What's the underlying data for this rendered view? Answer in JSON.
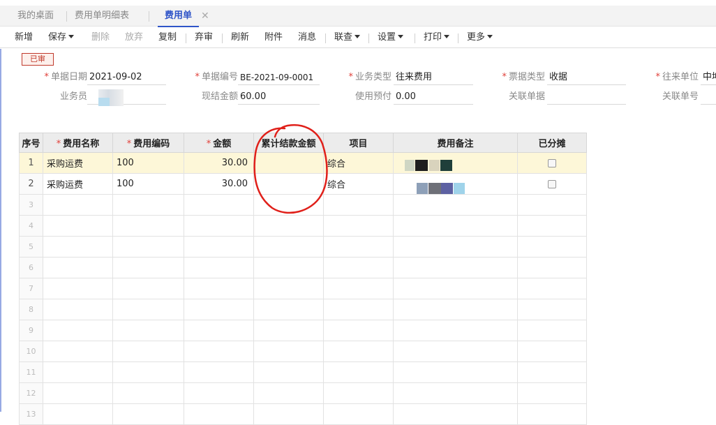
{
  "tabs": [
    {
      "label": "我的桌面",
      "active": false
    },
    {
      "label": "费用单明细表",
      "active": false
    },
    {
      "label": "费用单",
      "active": true
    }
  ],
  "toolbar": {
    "new": "新增",
    "save": "保存",
    "delete": "删除",
    "discard": "放弃",
    "copy": "复制",
    "unaudit": "弃审",
    "refresh": "刷新",
    "attachment": "附件",
    "message": "消息",
    "link": "联查",
    "settings": "设置",
    "print": "打印",
    "more": "更多"
  },
  "status_badge": "已审",
  "form": {
    "doc_date": {
      "label": "单据日期",
      "value": "2021-09-02",
      "required": true
    },
    "doc_no": {
      "label": "单据编号",
      "value": "BE-2021-09-0001",
      "required": true
    },
    "biz_type": {
      "label": "业务类型",
      "value": "往来费用",
      "required": true
    },
    "invoice_type": {
      "label": "票据类型",
      "value": "收据",
      "required": true
    },
    "partner": {
      "label": "往来单位",
      "value": "中坤",
      "required": true
    },
    "salesman": {
      "label": "业务员",
      "value": ""
    },
    "cash_amount": {
      "label": "现结金额",
      "value": "60.00"
    },
    "use_prepay": {
      "label": "使用预付",
      "value": "0.00"
    },
    "related_doc": {
      "label": "关联单据",
      "value": ""
    },
    "related_no": {
      "label": "关联单号",
      "value": ""
    }
  },
  "grid": {
    "columns": [
      {
        "label": "序号",
        "required": false
      },
      {
        "label": "费用名称",
        "required": true
      },
      {
        "label": "费用编码",
        "required": true
      },
      {
        "label": "金额",
        "required": true
      },
      {
        "label": "累计结款金额",
        "required": false
      },
      {
        "label": "项目",
        "required": false
      },
      {
        "label": "费用备注",
        "required": false
      },
      {
        "label": "已分摊",
        "required": false
      }
    ],
    "rows": [
      {
        "seq": "1",
        "name": "采购运费",
        "code": "100",
        "amount": "30.00",
        "settled": "",
        "project": "综合",
        "remark": "",
        "allocated": false
      },
      {
        "seq": "2",
        "name": "采购运费",
        "code": "100",
        "amount": "30.00",
        "settled": "",
        "project": "综合",
        "remark": "",
        "allocated": false
      }
    ],
    "empty_rows": [
      "3",
      "4",
      "5",
      "6",
      "7",
      "8",
      "9",
      "10",
      "11",
      "12",
      "13"
    ]
  },
  "colors": {
    "accent": "#2f54c8",
    "badge": "#c0392b",
    "required": "#e0403a",
    "selected_row": "#fdf7d8",
    "annotation": "#e0201a"
  }
}
